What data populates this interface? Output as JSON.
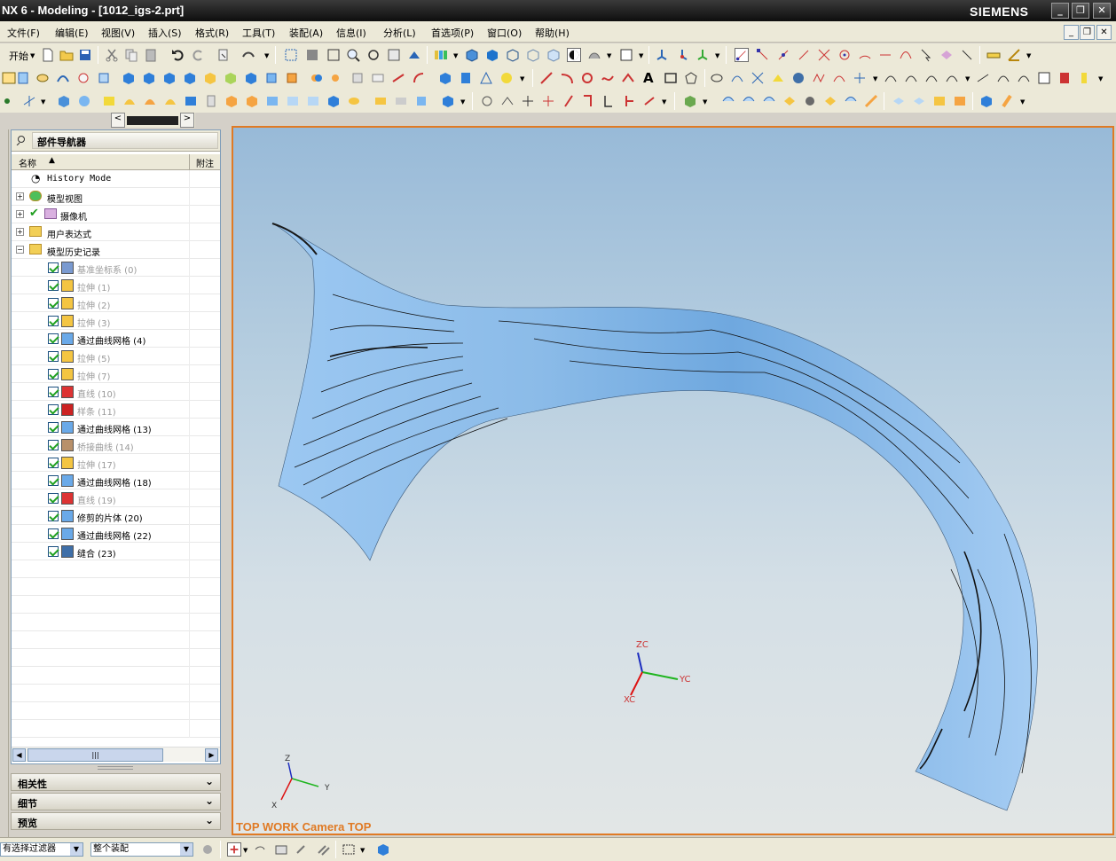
{
  "window": {
    "title": "NX 6 - Modeling - [1012_igs-2.prt]",
    "brand": "SIEMENS"
  },
  "menu": [
    "文件(F)",
    "编辑(E)",
    "视图(V)",
    "插入(S)",
    "格式(R)",
    "工具(T)",
    "装配(A)",
    "信息(I)",
    "分析(L)",
    "首选项(P)",
    "窗口(O)",
    "帮助(H)"
  ],
  "toolbar": {
    "start_label": "开始"
  },
  "navigator": {
    "title": "部件导航器",
    "col_name": "名称",
    "col_note": "附注",
    "items": [
      {
        "label": "History Mode"
      },
      {
        "label": "模型视图"
      },
      {
        "label": "摄像机"
      },
      {
        "label": "用户表达式"
      },
      {
        "label": "模型历史记录"
      },
      {
        "label": "基准坐标系 (0)"
      },
      {
        "label": "拉伸 (1)"
      },
      {
        "label": "拉伸 (2)"
      },
      {
        "label": "拉伸 (3)"
      },
      {
        "label": "通过曲线网格 (4)"
      },
      {
        "label": "拉伸 (5)"
      },
      {
        "label": "拉伸 (7)"
      },
      {
        "label": "直线 (10)"
      },
      {
        "label": "样条 (11)"
      },
      {
        "label": "通过曲线网格 (13)"
      },
      {
        "label": "桥接曲线 (14)"
      },
      {
        "label": "拉伸 (17)"
      },
      {
        "label": "通过曲线网格 (18)"
      },
      {
        "label": "直线 (19)"
      },
      {
        "label": "修剪的片体 (20)"
      },
      {
        "label": "通过曲线网格 (22)"
      },
      {
        "label": "缝合 (23)"
      }
    ],
    "panels": [
      "相关性",
      "细节",
      "预览"
    ]
  },
  "viewport": {
    "view_label": "TOP WORK Camera TOP",
    "axes": {
      "z": "ZC",
      "y": "YC",
      "x": "XC"
    },
    "mini_axes": {
      "z": "Z",
      "y": "Y",
      "x": "X"
    }
  },
  "status": {
    "filter": "有选择过滤器",
    "scope": "整个装配"
  },
  "colors": {
    "accent": "#e07a24",
    "surface": "#8fc0ea"
  }
}
